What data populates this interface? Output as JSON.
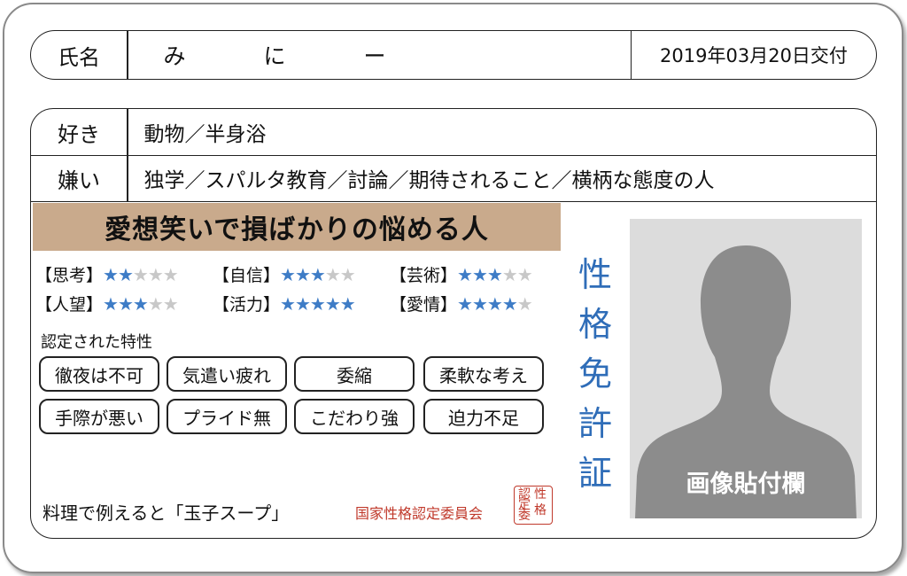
{
  "header": {
    "name_label": "氏名",
    "name_chars": [
      "み",
      "に",
      "ー"
    ],
    "issue_date": "2019年03月20日交付"
  },
  "likes": {
    "label": "好き",
    "value": "動物／半身浴"
  },
  "dislikes": {
    "label": "嫌い",
    "value": "独学／スパルタ教育／討論／期待されること／横柄な態度の人"
  },
  "headline": "愛想笑いで損ばかりの悩める人",
  "stats": [
    {
      "label": "【思考】",
      "stars": 2,
      "max": 5
    },
    {
      "label": "【自信】",
      "stars": 3,
      "max": 5
    },
    {
      "label": "【芸術】",
      "stars": 3,
      "max": 5
    },
    {
      "label": "【人望】",
      "stars": 3,
      "max": 5
    },
    {
      "label": "【活力】",
      "stars": 5,
      "max": 5
    },
    {
      "label": "【愛情】",
      "stars": 4,
      "max": 5
    }
  ],
  "traits": {
    "label": "認定された特性",
    "items": [
      "徹夜は不可",
      "気遣い疲れ",
      "委縮",
      "柔軟な考え",
      "手際が悪い",
      "プライド無",
      "こだわり強",
      "迫力不足"
    ]
  },
  "food_example": "料理で例えると「玉子スープ」",
  "committee": "国家性格認定委員会",
  "seal_chars": [
    "認",
    "性",
    "定",
    "格",
    "委"
  ],
  "vertical_title": [
    "性",
    "格",
    "免",
    "許",
    "証"
  ],
  "photo_label": "画像貼付欄",
  "colors": {
    "accent_blue": "#3e7cc6",
    "banner_tan": "#c9aa8c",
    "seal_red": "#c0392b",
    "photo_gray": "#8c8c8c"
  }
}
